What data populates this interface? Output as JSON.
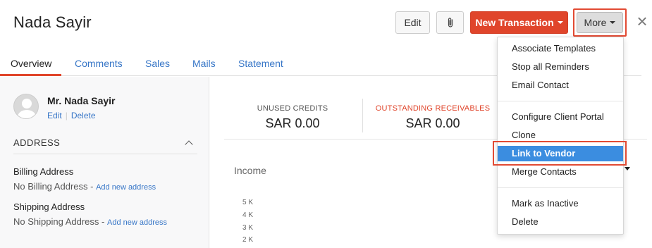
{
  "header": {
    "title": "Nada Sayir",
    "edit_label": "Edit",
    "new_transaction_label": "New Transaction",
    "more_label": "More",
    "close_glyph": "×"
  },
  "tabs": [
    {
      "label": "Overview",
      "active": true
    },
    {
      "label": "Comments"
    },
    {
      "label": "Sales"
    },
    {
      "label": "Mails"
    },
    {
      "label": "Statement"
    }
  ],
  "contact": {
    "name": "Mr. Nada Sayir",
    "edit_label": "Edit",
    "delete_label": "Delete"
  },
  "address": {
    "section_title": "ADDRESS",
    "billing_label": "Billing Address",
    "billing_value": "No Billing Address -",
    "billing_link": "Add new address",
    "shipping_label": "Shipping Address",
    "shipping_value": "No Shipping Address -",
    "shipping_link": "Add new address"
  },
  "summary": {
    "unused_credits_label": "UNUSED CREDITS",
    "unused_credits_value": "SAR 0.00",
    "receivables_label": "OUTSTANDING RECEIVABLES",
    "receivables_value": "SAR 0.00"
  },
  "income": {
    "title": "Income",
    "y_ticks": [
      "5 K",
      "4 K",
      "3 K",
      "2 K"
    ]
  },
  "more_menu": {
    "items": [
      "Associate Templates",
      "Stop all Reminders",
      "Email Contact",
      "Configure Client Portal",
      "Clone",
      "Link to Vendor",
      "Merge Contacts",
      "Mark as Inactive",
      "Delete"
    ],
    "selected": "Link to Vendor"
  },
  "colors": {
    "accent_red": "#e0452b",
    "link_blue": "#3776c7",
    "selected_blue": "#3b8de0"
  },
  "icons": [
    "paperclip-icon",
    "close-icon",
    "chevron-up-icon",
    "caret-down-icon",
    "avatar"
  ]
}
